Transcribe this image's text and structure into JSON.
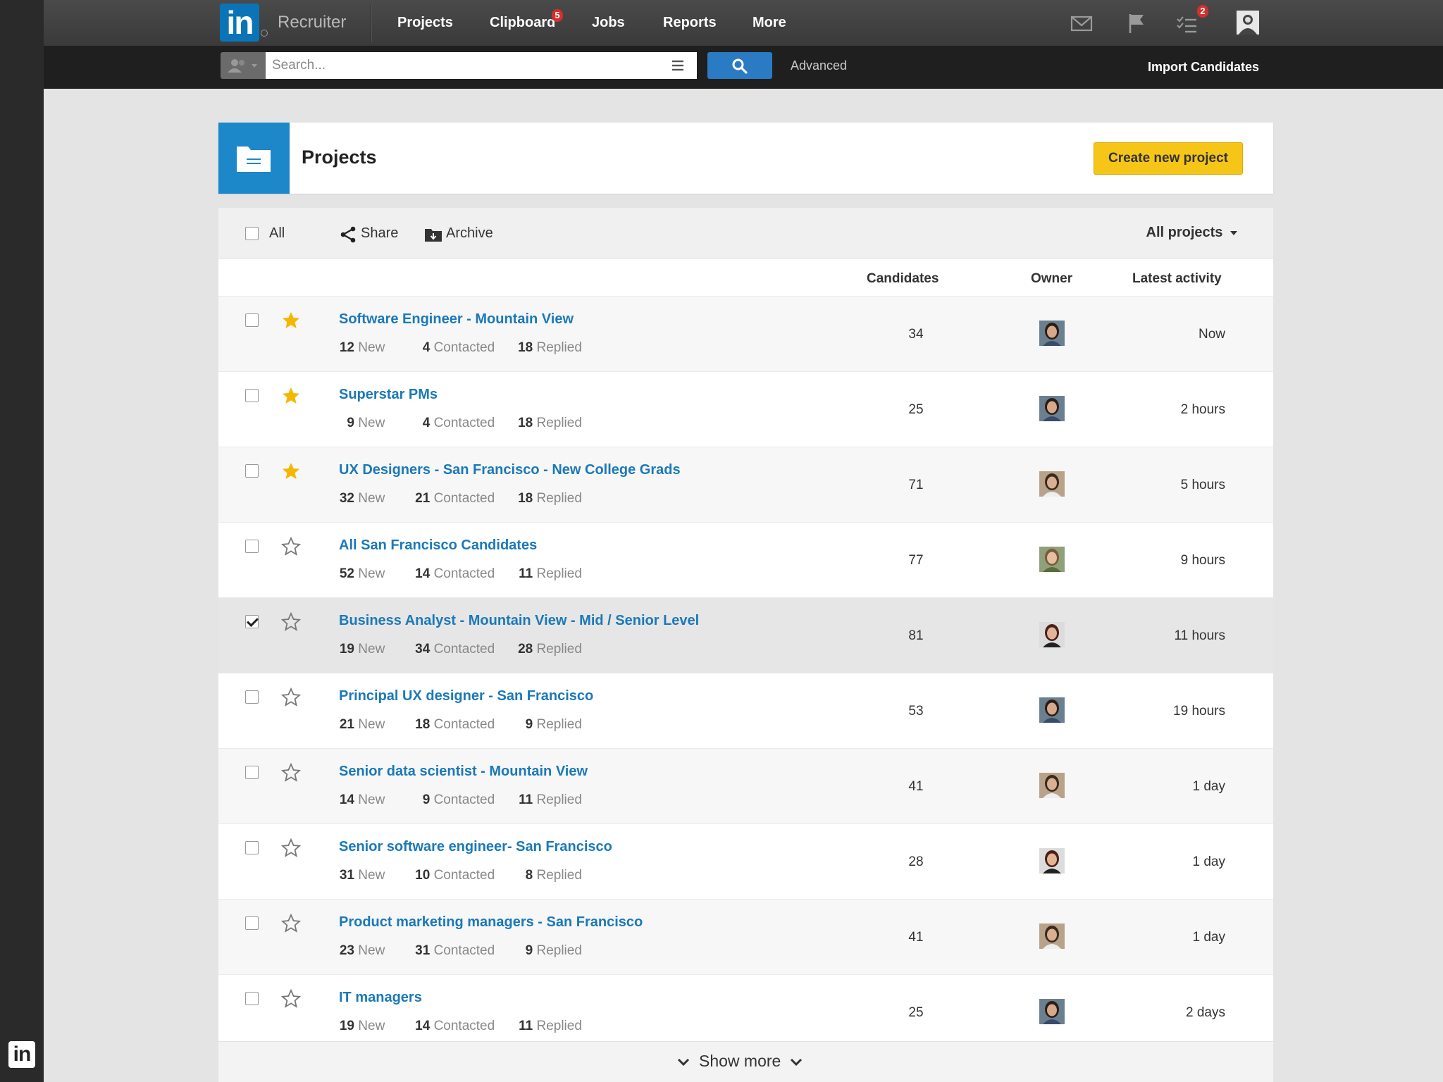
{
  "app": {
    "brand_logo": "in",
    "brand_name": "Recruiter",
    "rail_logo": "in"
  },
  "nav": {
    "items": [
      {
        "label": "Projects"
      },
      {
        "label": "Clipboard",
        "badge": "5"
      },
      {
        "label": "Jobs"
      },
      {
        "label": "Reports"
      },
      {
        "label": "More"
      }
    ],
    "icons": [
      "mail-icon",
      "flag-icon",
      "tasks-icon",
      "profile-icon"
    ],
    "tasks_badge": "2"
  },
  "search": {
    "placeholder": "Search...",
    "advanced_label": "Advanced",
    "import_label": "Import Candidates"
  },
  "header": {
    "title": "Projects",
    "create_label": "Create new project"
  },
  "toolbar": {
    "all_label": "All",
    "share_label": "Share",
    "archive_label": "Archive",
    "filter_label": "All projects"
  },
  "columns": {
    "candidates": "Candidates",
    "owner": "Owner",
    "activity": "Latest activity"
  },
  "stat_labels": {
    "new": "New",
    "contacted": "Contacted",
    "replied": "Replied"
  },
  "projects": [
    {
      "title": "Software Engineer - Mountain View",
      "new": "12",
      "contacted": "4",
      "replied": "18",
      "candidates": "34",
      "activity": "Now",
      "starred": true,
      "checked": false,
      "owner": "woman-dark"
    },
    {
      "title": "Superstar PMs",
      "new": "9",
      "contacted": "4",
      "replied": "18",
      "candidates": "25",
      "activity": "2 hours",
      "starred": true,
      "checked": false,
      "owner": "woman-dark"
    },
    {
      "title": "UX Designers - San Francisco - New College Grads",
      "new": "32",
      "contacted": "21",
      "replied": "18",
      "candidates": "71",
      "activity": "5 hours",
      "starred": true,
      "checked": false,
      "owner": "man"
    },
    {
      "title": "All San Francisco Candidates",
      "new": "52",
      "contacted": "14",
      "replied": "11",
      "candidates": "77",
      "activity": "9 hours",
      "starred": false,
      "checked": false,
      "owner": "woman-light"
    },
    {
      "title": "Business Analyst - Mountain View - Mid / Senior Level",
      "new": "19",
      "contacted": "34",
      "replied": "28",
      "candidates": "81",
      "activity": "11 hours",
      "starred": false,
      "checked": true,
      "owner": "woman-red"
    },
    {
      "title": "Principal UX designer - San Francisco",
      "new": "21",
      "contacted": "18",
      "replied": "9",
      "candidates": "53",
      "activity": "19 hours",
      "starred": false,
      "checked": false,
      "owner": "woman-dark"
    },
    {
      "title": "Senior data scientist - Mountain View",
      "new": "14",
      "contacted": "9",
      "replied": "11",
      "candidates": "41",
      "activity": "1 day",
      "starred": false,
      "checked": false,
      "owner": "man"
    },
    {
      "title": "Senior software engineer- San Francisco",
      "new": "31",
      "contacted": "10",
      "replied": "8",
      "candidates": "28",
      "activity": "1 day",
      "starred": false,
      "checked": false,
      "owner": "woman-red"
    },
    {
      "title": "Product marketing managers - San Francisco",
      "new": "23",
      "contacted": "31",
      "replied": "9",
      "candidates": "41",
      "activity": "1 day",
      "starred": false,
      "checked": false,
      "owner": "man"
    },
    {
      "title": "IT managers",
      "new": "19",
      "contacted": "14",
      "replied": "11",
      "candidates": "25",
      "activity": "2 days",
      "starred": false,
      "checked": false,
      "owner": "woman-dark"
    }
  ],
  "show_more_label": "Show more",
  "colors": {
    "link": "#1a79b8",
    "star_filled": "#f5b700",
    "create_button": "#f5c518",
    "header_icon_bg": "#1c87c9",
    "search_button": "#2b7bc4",
    "badge": "#d32f2f"
  }
}
